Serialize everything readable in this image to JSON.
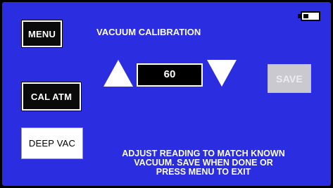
{
  "screen": {
    "title": "VACUUM CALIBRATION",
    "background_color": "#2b2de0"
  },
  "buttons": {
    "menu": "MENU",
    "cal_atm": "CAL ATM",
    "deep_vac": "DEEP VAC",
    "save": "SAVE"
  },
  "adjuster": {
    "value": "60",
    "increase_icon": "up-triangle",
    "decrease_icon": "down-triangle"
  },
  "instructions": {
    "lines": [
      "ADJUST READING TO MATCH KNOWN",
      "VACUUM. SAVE WHEN DONE OR",
      "PRESS MENU TO EXIT"
    ]
  },
  "status": {
    "battery_icon": "battery-icon",
    "battery_level": 0.35
  }
}
